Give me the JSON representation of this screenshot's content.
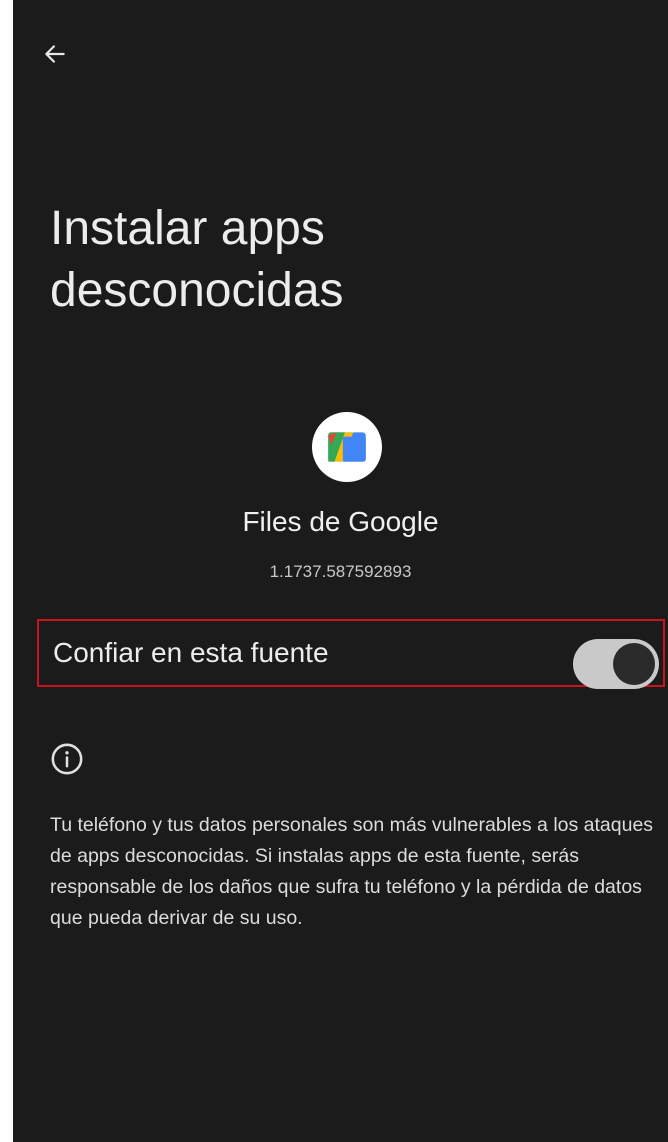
{
  "header": {
    "back_icon": "arrow-left-icon"
  },
  "page": {
    "title": "Instalar apps desconocidas"
  },
  "app": {
    "icon": "files-by-google-icon",
    "name": "Files de Google",
    "version": "1.1737.587592893"
  },
  "trust_setting": {
    "label": "Confiar en esta fuente",
    "enabled": true,
    "highlight_color": "#c8141c"
  },
  "info": {
    "icon": "info-icon",
    "text": "Tu teléfono y tus datos personales son más vulnerables a los ataques de apps desconocidas. Si instalas apps de esta fuente, serás responsable de los daños que sufra tu teléfono y la pérdida de datos que pueda derivar de su uso."
  },
  "colors": {
    "background": "#1b1b1b",
    "toggle_track": "#c9c9c9",
    "toggle_knob": "#2a2a2a"
  }
}
